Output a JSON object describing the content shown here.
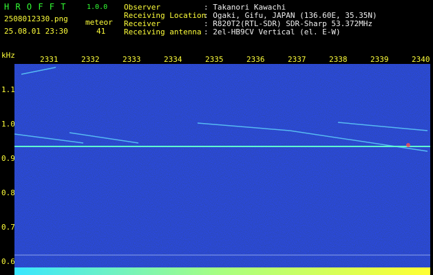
{
  "header": {
    "app_name": "H R O F F T",
    "version": "1.0.0",
    "filename": "2508012330.png",
    "datetime": "25.08.01 23:30",
    "meteor_label": "meteor",
    "meteor_count": "41"
  },
  "info": {
    "rows": [
      {
        "label": "Observer",
        "value": ": Takanori Kawachi"
      },
      {
        "label": "Receiving Location",
        "value": ": Ogaki, Gifu, JAPAN (136.60E, 35.35N)"
      },
      {
        "label": "Receiver",
        "value": ": R820T2(RTL-SDR) SDR-Sharp 53.372MHz"
      },
      {
        "label": "Receiving antenna",
        "value": ": 2el-HB9CV Vertical (el. E-W)"
      }
    ]
  },
  "axis": {
    "unit": "kHz",
    "top_ticks": [
      "2331",
      "2332",
      "2333",
      "2334",
      "2335",
      "2336",
      "2337",
      "2338",
      "2339",
      "2340"
    ],
    "y_ticks": [
      "1.1",
      "1.0",
      "0.9",
      "0.8",
      "0.7",
      "0.6"
    ]
  },
  "colors": {
    "background": "#000000",
    "noise": "#0a1a8a",
    "carrier": "#60ffd0",
    "meteor": "#66e0ff",
    "bottom_bars": "#39e6ff",
    "label_yellow": "#ffff3a",
    "label_green": "#33ff33"
  }
}
